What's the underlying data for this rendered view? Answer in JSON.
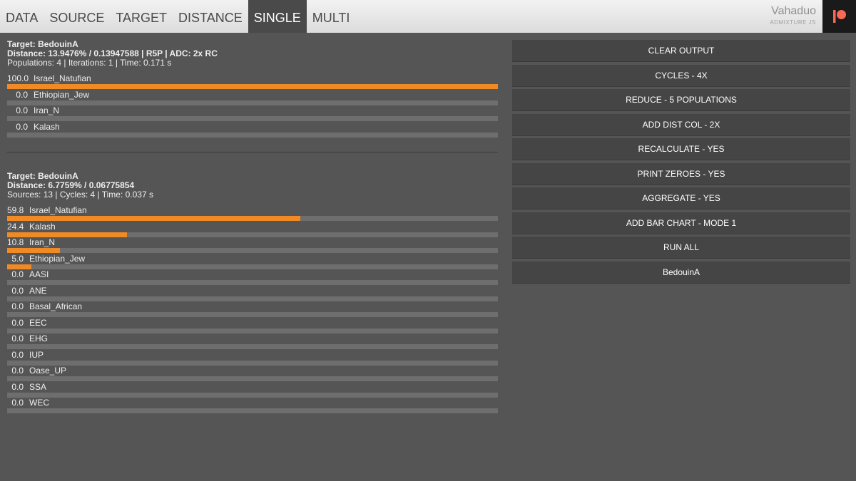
{
  "nav": {
    "tabs": [
      "DATA",
      "SOURCE",
      "TARGET",
      "DISTANCE",
      "SINGLE",
      "MULTI"
    ],
    "active_tab": "SINGLE",
    "brand_name": "Vahaduo",
    "brand_sub": "ADMIXTURE JS",
    "patreon_icon": "patreon-icon"
  },
  "colors": {
    "bar_fill": "#f08a24",
    "bar_track": "#6e6e6e",
    "background": "#555555"
  },
  "results": [
    {
      "target_line": "Target: BedouinA",
      "distance_line": "Distance: 13.9476% / 0.13947588 | R5P | ADC: 2x RC",
      "info_line": "Populations: 4 | Iterations: 1 | Time: 0.171 s",
      "rows": [
        {
          "value": "100.0",
          "name": "Israel_Natufian",
          "pct": 100.0
        },
        {
          "value": "0.0",
          "name": "Ethiopian_Jew",
          "pct": 0.0
        },
        {
          "value": "0.0",
          "name": "Iran_N",
          "pct": 0.0
        },
        {
          "value": "0.0",
          "name": "Kalash",
          "pct": 0.0
        }
      ]
    },
    {
      "target_line": "Target: BedouinA",
      "distance_line": "Distance: 6.7759% / 0.06775854",
      "info_line": "Sources: 13 | Cycles: 4 | Time: 0.037 s",
      "rows": [
        {
          "value": "59.8",
          "name": "Israel_Natufian",
          "pct": 59.8
        },
        {
          "value": "24.4",
          "name": "Kalash",
          "pct": 24.4
        },
        {
          "value": "10.8",
          "name": "Iran_N",
          "pct": 10.8
        },
        {
          "value": "5.0",
          "name": "Ethiopian_Jew",
          "pct": 5.0
        },
        {
          "value": "0.0",
          "name": "AASI",
          "pct": 0.0
        },
        {
          "value": "0.0",
          "name": "ANE",
          "pct": 0.0
        },
        {
          "value": "0.0",
          "name": "Basal_African",
          "pct": 0.0
        },
        {
          "value": "0.0",
          "name": "EEC",
          "pct": 0.0
        },
        {
          "value": "0.0",
          "name": "EHG",
          "pct": 0.0
        },
        {
          "value": "0.0",
          "name": "IUP",
          "pct": 0.0
        },
        {
          "value": "0.0",
          "name": "Oase_UP",
          "pct": 0.0
        },
        {
          "value": "0.0",
          "name": "SSA",
          "pct": 0.0
        },
        {
          "value": "0.0",
          "name": "WEC",
          "pct": 0.0
        }
      ]
    }
  ],
  "buttons": [
    "CLEAR OUTPUT",
    "CYCLES - 4X",
    "REDUCE - 5 POPULATIONS",
    "ADD DIST COL - 2X",
    "RECALCULATE - YES",
    "PRINT ZEROES - YES",
    "AGGREGATE - YES",
    "ADD BAR CHART - MODE 1",
    "RUN ALL",
    "BedouinA"
  ]
}
